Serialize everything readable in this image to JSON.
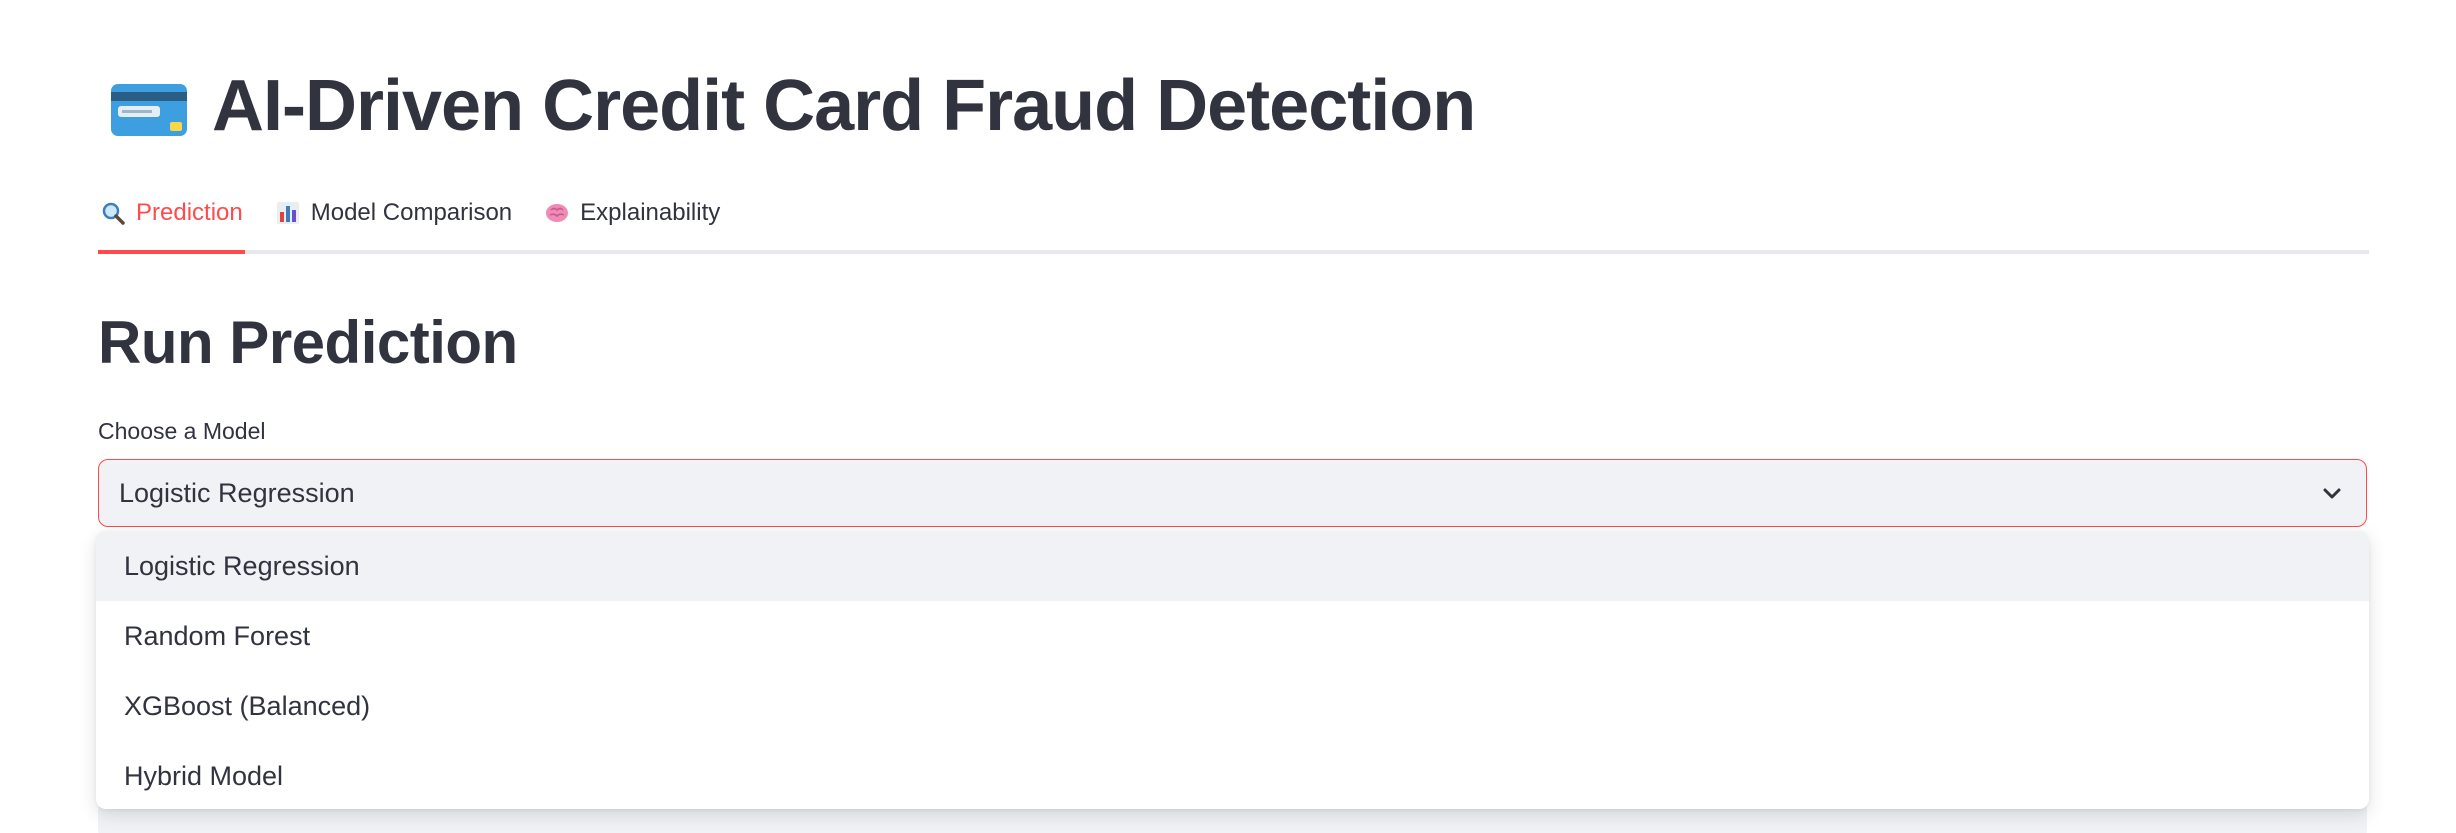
{
  "app": {
    "title": "AI-Driven Credit Card Fraud Detection",
    "title_icon": "credit-card-icon"
  },
  "tabs": [
    {
      "label": "Prediction",
      "icon": "magnifier-icon",
      "active": true
    },
    {
      "label": "Model Comparison",
      "icon": "bar-chart-icon",
      "active": false
    },
    {
      "label": "Explainability",
      "icon": "brain-icon",
      "active": false
    }
  ],
  "main": {
    "heading": "Run Prediction",
    "model_select": {
      "label": "Choose a Model",
      "value": "Logistic Regression",
      "expanded": true,
      "options": [
        "Logistic Regression",
        "Random Forest",
        "XGBoost (Balanced)",
        "Hybrid Model"
      ],
      "highlighted_option": "Logistic Regression"
    }
  },
  "colors": {
    "accent": "#ff4b4b",
    "text": "#31333f",
    "input_bg": "#f0f2f6",
    "tab_border": "#e8e8ec"
  }
}
